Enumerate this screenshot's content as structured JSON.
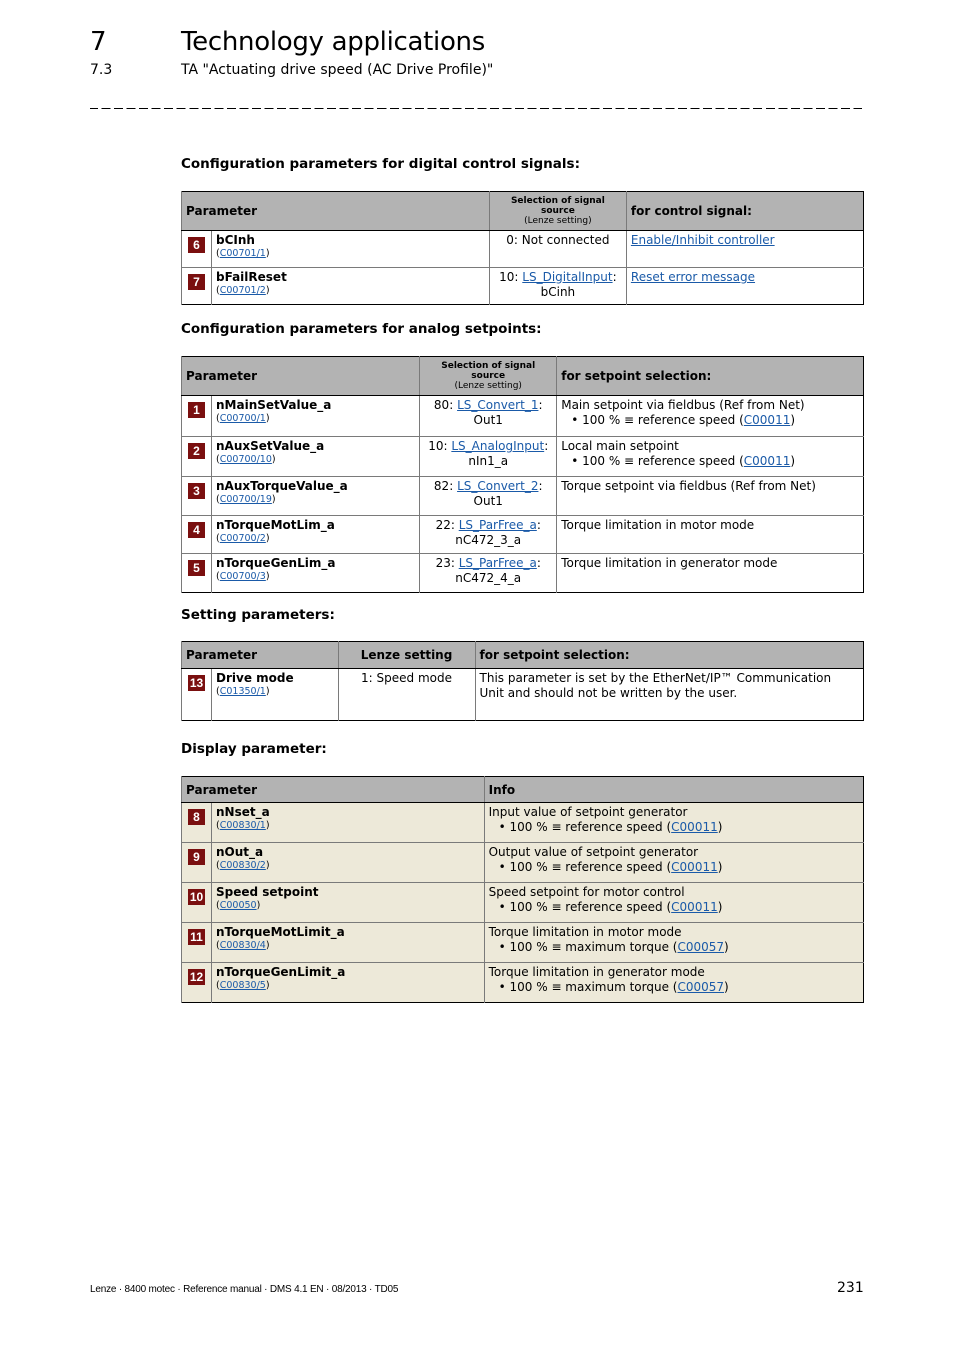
{
  "header": {
    "chapter_number": "7",
    "chapter_title": "Technology applications",
    "section_number": "7.3",
    "section_title": "TA \"Actuating drive speed (AC Drive Profile)\""
  },
  "digital": {
    "heading": "Configuration parameters for digital control signals:",
    "col_param": "Parameter",
    "col_source_top": "Selection of signal source",
    "col_source_sub": "(Lenze setting)",
    "col_signal": "for control signal:",
    "rows": [
      {
        "badge": "6",
        "name": "bCInh",
        "code": "C00701/1",
        "source_prefix": "0: Not connected",
        "source_link": "",
        "source_suffix": "",
        "source_line2": "",
        "signal_link": "Enable/Inhibit controller"
      },
      {
        "badge": "7",
        "name": "bFailReset",
        "code": "C00701/2",
        "source_prefix": "10: ",
        "source_link": "LS_DigitalInput",
        "source_suffix": ":",
        "source_line2": "bCinh",
        "signal_link": "Reset error message"
      }
    ]
  },
  "analog": {
    "heading": "Configuration parameters for analog setpoints:",
    "col_param": "Parameter",
    "col_source_top": "Selection of signal source",
    "col_source_sub": "(Lenze setting)",
    "col_setpoint": "for setpoint selection:",
    "rows": [
      {
        "badge": "1",
        "name": "nMainSetValue_a",
        "code": "C00700/1",
        "source_prefix": "80: ",
        "source_link": "LS_Convert_1",
        "source_suffix": ":",
        "source_line2": "Out1",
        "desc": "Main setpoint via fieldbus (Ref from Net)",
        "bullet_pre": "• 100 % ≡ reference speed (",
        "bullet_link": "C00011",
        "bullet_post": ")"
      },
      {
        "badge": "2",
        "name": "nAuxSetValue_a",
        "code": "C00700/10",
        "source_prefix": "10: ",
        "source_link": "LS_AnalogInput",
        "source_suffix": ":",
        "source_line2": "nIn1_a",
        "desc": "Local main setpoint",
        "bullet_pre": "• 100 % ≡ reference speed (",
        "bullet_link": "C00011",
        "bullet_post": ")"
      },
      {
        "badge": "3",
        "name": "nAuxTorqueValue_a",
        "code": "C00700/19",
        "source_prefix": "82: ",
        "source_link": "LS_Convert_2",
        "source_suffix": ":",
        "source_line2": "Out1",
        "desc": "Torque setpoint via fieldbus (Ref from Net)",
        "bullet_pre": "",
        "bullet_link": "",
        "bullet_post": ""
      },
      {
        "badge": "4",
        "name": "nTorqueMotLim_a",
        "code": "C00700/2",
        "source_prefix": "22: ",
        "source_link": "LS_ParFree_a",
        "source_suffix": ":",
        "source_line2": "nC472_3_a",
        "desc": "Torque limitation in motor mode",
        "bullet_pre": "",
        "bullet_link": "",
        "bullet_post": ""
      },
      {
        "badge": "5",
        "name": "nTorqueGenLim_a",
        "code": "C00700/3",
        "source_prefix": "23: ",
        "source_link": "LS_ParFree_a",
        "source_suffix": ":",
        "source_line2": "nC472_4_a",
        "desc": "Torque limitation in generator mode",
        "bullet_pre": "",
        "bullet_link": "",
        "bullet_post": ""
      }
    ]
  },
  "setting": {
    "heading": "Setting parameters:",
    "col_param": "Parameter",
    "col_lenze": "Lenze setting",
    "col_setpoint": "for setpoint selection:",
    "rows": [
      {
        "badge": "13",
        "name": "Drive mode",
        "code": "C01350/1",
        "value": "1: Speed mode",
        "desc": "This parameter is set by the EtherNet/IP™ Communication Unit and should not be written by the user."
      }
    ]
  },
  "display": {
    "heading": "Display parameter:",
    "col_param": "Parameter",
    "col_info": "Info",
    "rows": [
      {
        "badge": "8",
        "name": "nNset_a",
        "code": "C00830/1",
        "desc": "Input value of setpoint generator",
        "bullet_pre": "• 100 % ≡ reference speed (",
        "bullet_link": "C00011",
        "bullet_post": ")"
      },
      {
        "badge": "9",
        "name": "nOut_a",
        "code": "C00830/2",
        "desc": "Output value of setpoint generator",
        "bullet_pre": "• 100 % ≡ reference speed (",
        "bullet_link": "C00011",
        "bullet_post": ")"
      },
      {
        "badge": "10",
        "name": "Speed setpoint",
        "code": "C00050",
        "desc": "Speed setpoint for motor control",
        "bullet_pre": "• 100 % ≡ reference speed (",
        "bullet_link": "C00011",
        "bullet_post": ")"
      },
      {
        "badge": "11",
        "name": "nTorqueMotLimit_a",
        "code": "C00830/4",
        "desc": "Torque limitation in motor mode",
        "bullet_pre": "• 100 % ≡ maximum torque (",
        "bullet_link": "C00057",
        "bullet_post": ")"
      },
      {
        "badge": "12",
        "name": "nTorqueGenLimit_a",
        "code": "C00830/5",
        "desc": "Torque limitation in generator mode",
        "bullet_pre": "• 100 % ≡ maximum torque (",
        "bullet_link": "C00057",
        "bullet_post": ")"
      }
    ]
  },
  "footer": {
    "left": "Lenze · 8400 motec · Reference manual · DMS 4.1 EN · 08/2013 · TD05",
    "page_number": "231"
  },
  "colors": {
    "badge": "#7a0f0f",
    "header_bg": "#b3b3b3",
    "display_row_bg": "#ede9d9",
    "link": "#1a5aa8"
  }
}
